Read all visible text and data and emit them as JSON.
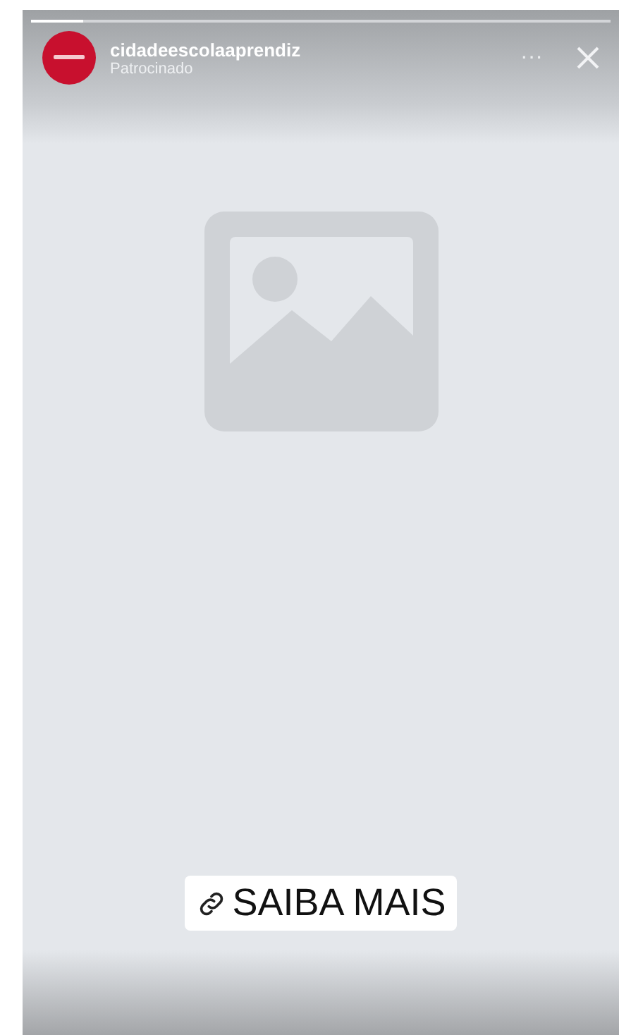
{
  "story": {
    "progress": {
      "level": 0.09
    },
    "account": {
      "username": "cidadeescolaaprendiz",
      "label": "Patrocinado"
    },
    "menu": "···",
    "media": {
      "kind": "placeholder"
    },
    "cta": {
      "label": "SAIBA MAIS"
    }
  }
}
